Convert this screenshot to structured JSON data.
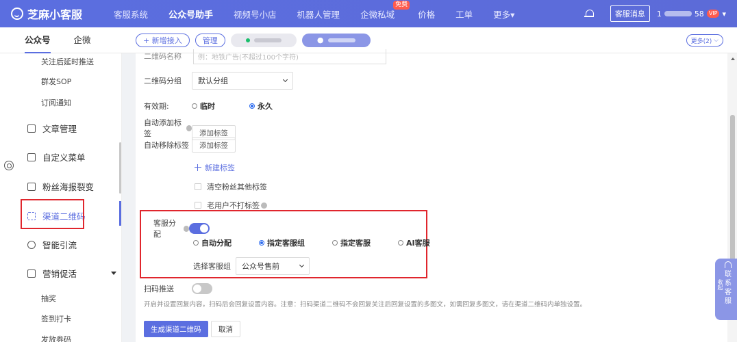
{
  "topnav": {
    "brand": "芝麻小客服",
    "items": [
      "客服系统",
      "公众号助手",
      "视频号小店",
      "机器人管理",
      "企微私域",
      "价格",
      "工单",
      "更多"
    ],
    "active_index": 1,
    "free_badge": "免费",
    "message_button": "客服消息",
    "user_prefix": "1",
    "user_suffix": "58",
    "vip_badge": "VIP"
  },
  "subhead": {
    "tabs": [
      "公众号",
      "企微"
    ],
    "add_button": "+ 新增接入",
    "manage_button": "管理",
    "more_button": "更多(2)"
  },
  "sidebar": {
    "sub_top": [
      "关注后延时推送",
      "群发SOP",
      "订阅通知"
    ],
    "main": [
      "文章管理",
      "自定义菜单",
      "粉丝海报裂变",
      "渠道二维码",
      "智能引流",
      "营销促活"
    ],
    "active": "渠道二维码",
    "sub_bottom": [
      "抽奖",
      "签到打卡",
      "发放券码"
    ]
  },
  "form": {
    "top_input_label": "二维码名称",
    "top_input_placeholder": "例：地铁广告(不超过100个字符)",
    "group_label": "二维码分组",
    "group_value": "默认分组",
    "validity_label": "有效期:",
    "validity_options": [
      "临时",
      "永久"
    ],
    "validity_selected": 1,
    "auto_add_label": "自动添加标签",
    "auto_add_btn": "添加标签",
    "auto_remove_label": "自动移除标签",
    "auto_remove_btn": "添加标签",
    "new_tag": "新建标签",
    "clear_tags": "清空粉丝其他标签",
    "no_tag_old": "老用户不打标签",
    "assign_label": "客服分配",
    "assign_options": [
      "自动分配",
      "指定客服组",
      "指定客服",
      "AI客服"
    ],
    "assign_selected": 1,
    "group_select_label": "选择客服组",
    "group_select_value": "公众号售前",
    "scan_push_label": "扫码推送",
    "note": "开启并设置回复内容，扫码后会回复设置内容。注意：扫码渠道二维码不会回复关注后回复设置的多图文，如需回复多图文，请在渠道二维码内单独设置。",
    "submit_btn": "生成渠道二维码",
    "cancel_btn": "取消"
  },
  "widget": {
    "collapse": "收起",
    "contact": [
      "联",
      "系",
      "客",
      "服"
    ]
  },
  "colors": {
    "primary": "#5b6ee0",
    "highlight_red": "#e0262d"
  }
}
